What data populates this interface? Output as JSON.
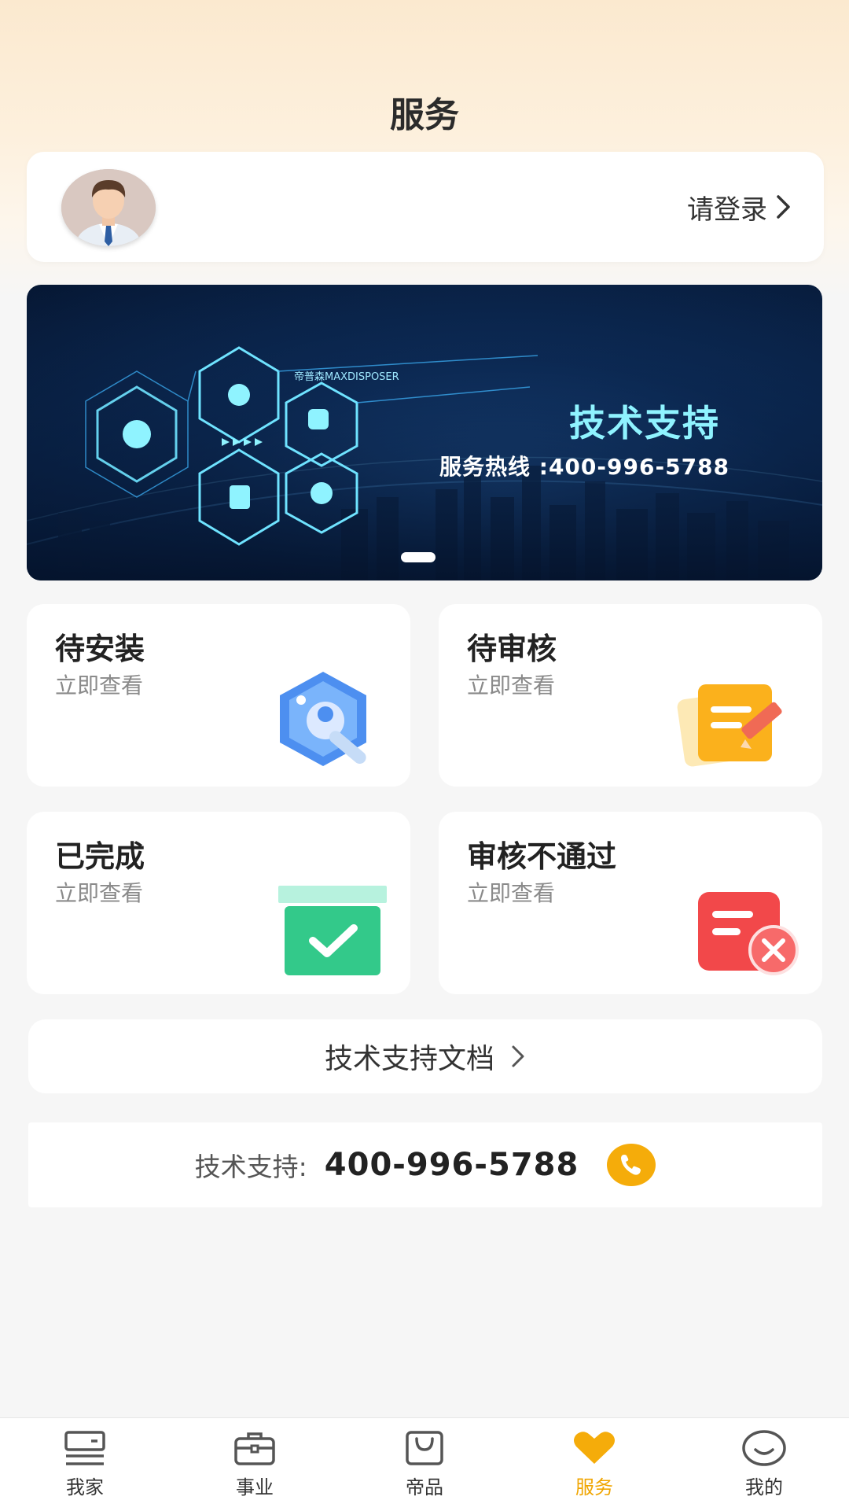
{
  "header": {
    "title": "服务"
  },
  "login_card": {
    "login_label": "请登录"
  },
  "banner": {
    "brand": "帝普森MAXDISPOSER",
    "title": "技术支持",
    "hotline": "服务热线 :400-996-5788"
  },
  "cards": [
    {
      "title": "待安装",
      "subtitle": "立即查看",
      "icon": "wrench-hexagon-icon"
    },
    {
      "title": "待审核",
      "subtitle": "立即查看",
      "icon": "document-pen-icon"
    },
    {
      "title": "已完成",
      "subtitle": "立即查看",
      "icon": "box-check-icon"
    },
    {
      "title": "审核不通过",
      "subtitle": "立即查看",
      "icon": "document-reject-icon"
    }
  ],
  "docs": {
    "label": "技术支持文档"
  },
  "support": {
    "label": "技术支持:",
    "number": "400-996-5788"
  },
  "tabbar": {
    "active_index": 3,
    "items": [
      {
        "label": "我家",
        "icon": "home-icon"
      },
      {
        "label": "事业",
        "icon": "briefcase-icon"
      },
      {
        "label": "帝品",
        "icon": "shopping-bag-icon"
      },
      {
        "label": "服务",
        "icon": "heart-icon"
      },
      {
        "label": "我的",
        "icon": "smile-icon"
      }
    ]
  },
  "colors": {
    "accent": "#f5ac0a",
    "active_tab": "#f0a500",
    "banner_title": "#8ff3ff"
  }
}
